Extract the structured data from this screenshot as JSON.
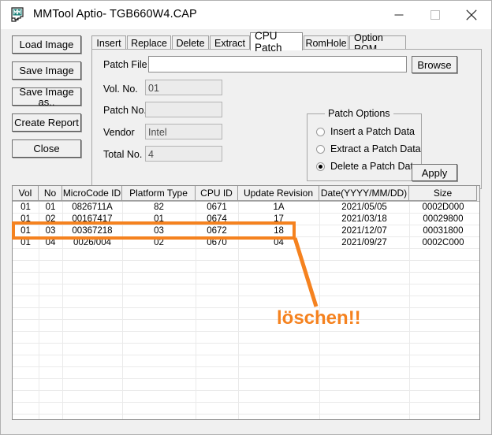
{
  "window": {
    "title": "MMTool Aptio- TGB660W4.CAP",
    "icon": "mmtool-app-icon",
    "controls": {
      "minimize": "—",
      "maximize": "□",
      "close": "✕"
    }
  },
  "side_buttons": [
    {
      "label": "Load Image",
      "name": "load-image-button"
    },
    {
      "label": "Save Image",
      "name": "save-image-button"
    },
    {
      "label": "Save Image as..",
      "name": "save-image-as-button"
    },
    {
      "label": "Create Report",
      "name": "create-report-button"
    },
    {
      "label": "Close",
      "name": "close-button"
    }
  ],
  "tabs": [
    {
      "label": "Insert",
      "active": false
    },
    {
      "label": "Replace",
      "active": false
    },
    {
      "label": "Delete",
      "active": false
    },
    {
      "label": "Extract",
      "active": false
    },
    {
      "label": "CPU Patch",
      "active": true
    },
    {
      "label": "RomHole",
      "active": false
    },
    {
      "label": "Option ROM",
      "active": false
    }
  ],
  "form": {
    "patch_file": {
      "label": "Patch File",
      "value": "",
      "placeholder": ""
    },
    "vol_no": {
      "label": "Vol. No.",
      "value": "01",
      "readonly": true
    },
    "patch_no": {
      "label": "Patch No.",
      "value": "",
      "readonly": true
    },
    "vendor": {
      "label": "Vendor",
      "value": "Intel",
      "readonly": true
    },
    "total_no": {
      "label": "Total No.",
      "value": "4",
      "readonly": true
    },
    "browse_label": "Browse",
    "apply_label": "Apply"
  },
  "patch_options": {
    "title": "Patch Options",
    "options": [
      {
        "label": "Insert a Patch Data",
        "selected": false
      },
      {
        "label": "Extract a Patch Data",
        "selected": false
      },
      {
        "label": "Delete a Patch Data",
        "selected": true
      }
    ]
  },
  "table": {
    "columns": [
      "Vol",
      "No",
      "MicroCode ID",
      "Platform Type",
      "CPU ID",
      "Update Revision",
      "Date(YYYY/MM/DD)",
      "Size"
    ],
    "rows": [
      [
        "01",
        "01",
        "0826711A",
        "82",
        "0671",
        "1A",
        "2021/05/05",
        "0002D000"
      ],
      [
        "01",
        "02",
        "00167417",
        "01",
        "0674",
        "17",
        "2021/03/18",
        "00029800"
      ],
      [
        "01",
        "03",
        "00367218",
        "03",
        "0672",
        "18",
        "2021/12/07",
        "00031800"
      ],
      [
        "01",
        "04",
        "0026/004",
        "02",
        "0670",
        "04",
        "2021/09/27",
        "0002C000"
      ]
    ],
    "highlighted_row_index": 2
  },
  "annotation": {
    "text": "löschen!!",
    "color": "#f5821f"
  }
}
